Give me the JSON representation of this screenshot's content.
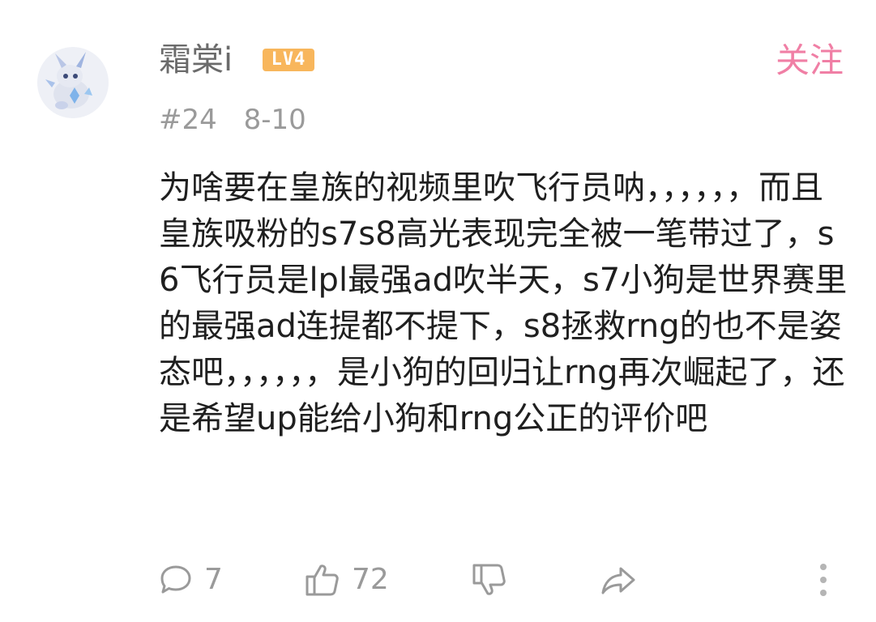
{
  "comment": {
    "username": "霜棠i",
    "level_badge": "LV4",
    "follow_label": "关注",
    "floor": "#24",
    "date": "8-10",
    "text": "为啥要在皇族的视频里吹飞行员呐，，，，，，而且皇族吸粉的s7s8高光表现完全被一笔带过了，s6飞行员是lpl最强ad吹半天，s7小狗是世界赛里的最强ad连提都不提下，s8拯救rng的也不是姿态吧，，，，，，是小狗的回归让rng再次崛起了，还是希望up能给小狗和rng公正的评价吧"
  },
  "actions": {
    "reply_count": "7",
    "like_count": "72"
  },
  "icons": {
    "reply": "reply-bubble-icon",
    "like": "thumbs-up-icon",
    "dislike": "thumbs-down-icon",
    "share": "share-arrow-icon",
    "more": "more-vertical-icon"
  },
  "colors": {
    "follow": "#f07fa5",
    "level_badge": "#f8b65c",
    "muted": "#9a9a9a"
  }
}
